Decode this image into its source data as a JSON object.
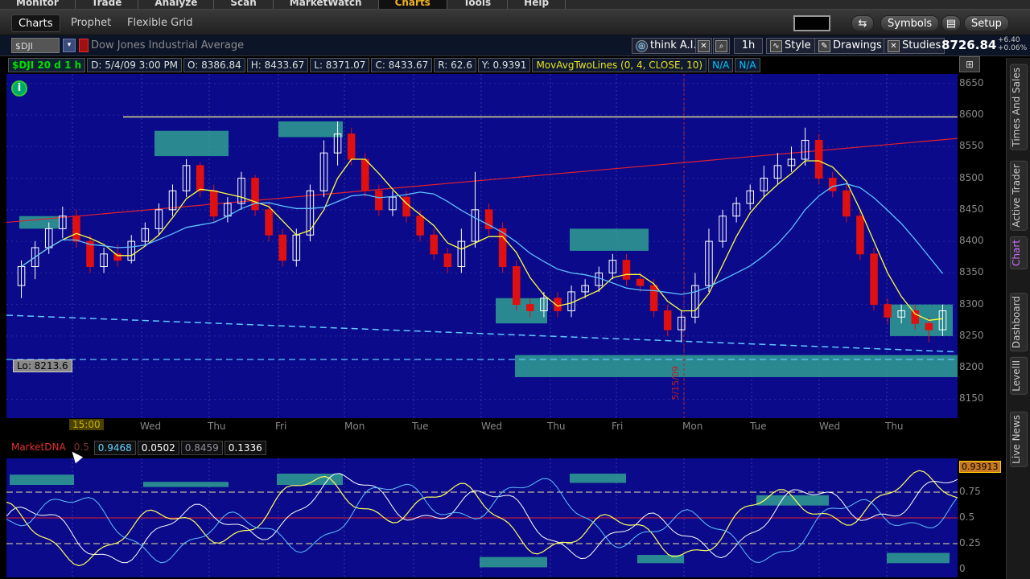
{
  "topmenu": [
    {
      "label": "Monitor",
      "active": false
    },
    {
      "label": "Trade",
      "active": false
    },
    {
      "label": "Analyze",
      "active": false
    },
    {
      "label": "Scan",
      "active": false
    },
    {
      "label": "MarketWatch",
      "active": false
    },
    {
      "label": "Charts",
      "active": true
    },
    {
      "label": "Tools",
      "active": false
    },
    {
      "label": "Help",
      "active": false
    }
  ],
  "subtabs": {
    "charts": "Charts",
    "prophet": "Prophet",
    "flexible_grid": "Flexible Grid",
    "symbols_button": "Symbols",
    "setup_button": "Setup"
  },
  "symbol": {
    "ticker": "$DJI",
    "name": "Dow Jones Industrial Average",
    "price": "8726.84",
    "change_top": "+6.40",
    "change_bottom": "+0.06%"
  },
  "toolbar": {
    "think_ai": "think A.I.",
    "timeframe": "1h",
    "style": "Style",
    "drawings": "Drawings",
    "studies": "Studies"
  },
  "infobar": {
    "symbol_period": "$DJI 20 d 1 h",
    "date": "D: 5/4/09 3:00 PM",
    "open": "O: 8386.84",
    "high": "H: 8433.67",
    "low": "L: 8371.07",
    "close": "C: 8433.67",
    "range": "R: 62.6",
    "y": "Y: 0.9391",
    "study": "MovAvgTwoLines (0, 4, CLOSE, 10)",
    "na1": "N/A",
    "na2": "N/A"
  },
  "chart_data": {
    "type": "candlestick",
    "title": "",
    "y_ticks": [
      8650,
      8600,
      8550,
      8500,
      8450,
      8400,
      8350,
      8300,
      8250,
      8200,
      8150
    ],
    "ylim": [
      8120,
      8665
    ],
    "x_labels": [
      "15:00",
      "Wed",
      "Thu",
      "Fri",
      "Mon",
      "Tue",
      "Wed",
      "Thu",
      "Fri",
      "Mon",
      "Tue",
      "Wed",
      "Thu"
    ],
    "low_label": "Lo: 8213.6",
    "date_marker": "5/15/09",
    "candles": [
      [
        8330,
        8360,
        8310,
        8370
      ],
      [
        8360,
        8390,
        8340,
        8400
      ],
      [
        8390,
        8420,
        8380,
        8430
      ],
      [
        8420,
        8440,
        8405,
        8455
      ],
      [
        8440,
        8400,
        8390,
        8450
      ],
      [
        8400,
        8360,
        8350,
        8410
      ],
      [
        8360,
        8380,
        8350,
        8390
      ],
      [
        8380,
        8370,
        8360,
        8395
      ],
      [
        8370,
        8400,
        8365,
        8410
      ],
      [
        8400,
        8420,
        8395,
        8430
      ],
      [
        8420,
        8450,
        8410,
        8460
      ],
      [
        8450,
        8480,
        8440,
        8490
      ],
      [
        8480,
        8520,
        8470,
        8530
      ],
      [
        8520,
        8480,
        8470,
        8525
      ],
      [
        8480,
        8440,
        8430,
        8490
      ],
      [
        8440,
        8460,
        8430,
        8470
      ],
      [
        8460,
        8500,
        8450,
        8510
      ],
      [
        8500,
        8450,
        8440,
        8505
      ],
      [
        8450,
        8410,
        8400,
        8460
      ],
      [
        8410,
        8370,
        8360,
        8420
      ],
      [
        8370,
        8410,
        8360,
        8420
      ],
      [
        8410,
        8480,
        8400,
        8490
      ],
      [
        8480,
        8540,
        8470,
        8560
      ],
      [
        8540,
        8570,
        8520,
        8590
      ],
      [
        8570,
        8530,
        8520,
        8580
      ],
      [
        8530,
        8480,
        8470,
        8540
      ],
      [
        8480,
        8450,
        8440,
        8490
      ],
      [
        8450,
        8470,
        8440,
        8480
      ],
      [
        8470,
        8440,
        8430,
        8480
      ],
      [
        8440,
        8410,
        8400,
        8450
      ],
      [
        8410,
        8380,
        8370,
        8420
      ],
      [
        8380,
        8360,
        8350,
        8390
      ],
      [
        8360,
        8400,
        8350,
        8420
      ],
      [
        8400,
        8450,
        8390,
        8510
      ],
      [
        8450,
        8420,
        8410,
        8460
      ],
      [
        8420,
        8360,
        8350,
        8430
      ],
      [
        8360,
        8300,
        8290,
        8370
      ],
      [
        8300,
        8290,
        8280,
        8310
      ],
      [
        8290,
        8310,
        8280,
        8320
      ],
      [
        8310,
        8290,
        8280,
        8320
      ],
      [
        8290,
        8320,
        8280,
        8330
      ],
      [
        8320,
        8330,
        8310,
        8340
      ],
      [
        8330,
        8350,
        8320,
        8360
      ],
      [
        8350,
        8370,
        8340,
        8380
      ],
      [
        8370,
        8340,
        8330,
        8380
      ],
      [
        8340,
        8330,
        8320,
        8350
      ],
      [
        8330,
        8290,
        8280,
        8340
      ],
      [
        8290,
        8260,
        8250,
        8300
      ],
      [
        8260,
        8280,
        8240,
        8290
      ],
      [
        8280,
        8330,
        8270,
        8350
      ],
      [
        8330,
        8400,
        8320,
        8420
      ],
      [
        8400,
        8440,
        8390,
        8450
      ],
      [
        8440,
        8460,
        8430,
        8470
      ],
      [
        8460,
        8480,
        8450,
        8490
      ],
      [
        8480,
        8500,
        8470,
        8520
      ],
      [
        8500,
        8520,
        8490,
        8540
      ],
      [
        8520,
        8530,
        8510,
        8550
      ],
      [
        8530,
        8560,
        8520,
        8580
      ],
      [
        8560,
        8500,
        8490,
        8570
      ],
      [
        8500,
        8480,
        8470,
        8510
      ],
      [
        8480,
        8440,
        8430,
        8490
      ],
      [
        8440,
        8380,
        8370,
        8450
      ],
      [
        8380,
        8300,
        8290,
        8390
      ],
      [
        8300,
        8280,
        8270,
        8310
      ],
      [
        8280,
        8290,
        8270,
        8300
      ],
      [
        8290,
        8270,
        8260,
        8300
      ],
      [
        8270,
        8260,
        8240,
        8280
      ],
      [
        8260,
        8290,
        8250,
        8300
      ]
    ]
  },
  "lower": {
    "study": "MarketDNA",
    "study_param": "0.5",
    "val1": "0.9468",
    "val2": "0.0502",
    "val3": "0.8459",
    "val4": "0.1336",
    "cursor_value": "0.93913",
    "y_ticks": [
      "0.75",
      "0.5",
      "0.25",
      "0"
    ]
  },
  "rightbar_tabs": [
    {
      "label": "Times And Sales",
      "active": false
    },
    {
      "label": "Active Trader",
      "active": false
    },
    {
      "label": "Chart",
      "active": true
    },
    {
      "label": "Dashboard",
      "active": false
    },
    {
      "label": "LevelII",
      "active": false
    },
    {
      "label": "Live News",
      "active": false
    }
  ],
  "colors": {
    "chart_bg": "#0a0a8a",
    "candle_up": "#ffffff",
    "candle_down": "#e01010",
    "ma_fast": "#ffff40",
    "ma_slow": "#60c0ff",
    "zone": "#30a090",
    "accent": "#f0b020"
  }
}
